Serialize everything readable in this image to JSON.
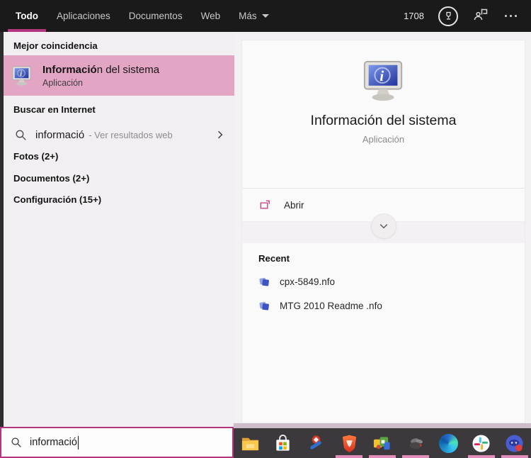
{
  "colors": {
    "accent": "#b5357f",
    "best_match_highlight": "#e2a6c4",
    "running_indicator": "#e18fba",
    "topbar_bg": "#1b1a1b"
  },
  "topbar": {
    "tabs": [
      {
        "label": "Todo",
        "active": true
      },
      {
        "label": "Aplicaciones",
        "active": false
      },
      {
        "label": "Documentos",
        "active": false
      },
      {
        "label": "Web",
        "active": false
      },
      {
        "label": "Más",
        "active": false,
        "has_dropdown": true
      }
    ],
    "rewards_points": "1708",
    "icons": [
      "rewards-trophy-icon",
      "feedback-icon",
      "more-options-icon"
    ]
  },
  "left_panel": {
    "best_match_header": "Mejor coincidencia",
    "best_match": {
      "title_match": "Informació",
      "title_rest": "n del sistema",
      "subtitle": "Aplicación",
      "icon": "system-information-icon"
    },
    "web_search_header": "Buscar en Internet",
    "web_suggestion": {
      "query": "informació",
      "hint": "- Ver resultados web",
      "icons": [
        "search-icon",
        "chevron-right-icon"
      ]
    },
    "categories": [
      {
        "label": "Fotos (2+)"
      },
      {
        "label": "Documentos (2+)"
      },
      {
        "label": "Configuración (15+)"
      }
    ]
  },
  "right_panel": {
    "app_title": "Información del sistema",
    "app_subtitle": "Aplicación",
    "app_icon": "system-information-icon",
    "actions": [
      {
        "label": "Abrir",
        "icon": "launch-icon"
      }
    ],
    "expand_icon": "chevron-down-icon",
    "recent_header": "Recent",
    "recent_items": [
      {
        "name": "cpx-5849.nfo",
        "icon": "nfo-file-icon"
      },
      {
        "name": "MTG 2010 Readme .nfo",
        "icon": "nfo-file-icon"
      }
    ]
  },
  "search_box": {
    "value": "informació",
    "icon": "search-icon"
  },
  "taskbar": {
    "icons": [
      {
        "name": "file-explorer",
        "running": false
      },
      {
        "name": "microsoft-store",
        "running": false
      },
      {
        "name": "tool-app",
        "running": false
      },
      {
        "name": "brave-browser",
        "running": true
      },
      {
        "name": "game-app",
        "running": true
      },
      {
        "name": "fly-utility-app",
        "running": true
      },
      {
        "name": "microsoft-edge",
        "running": false
      },
      {
        "name": "slack",
        "running": true
      },
      {
        "name": "discord",
        "running": true
      }
    ]
  }
}
